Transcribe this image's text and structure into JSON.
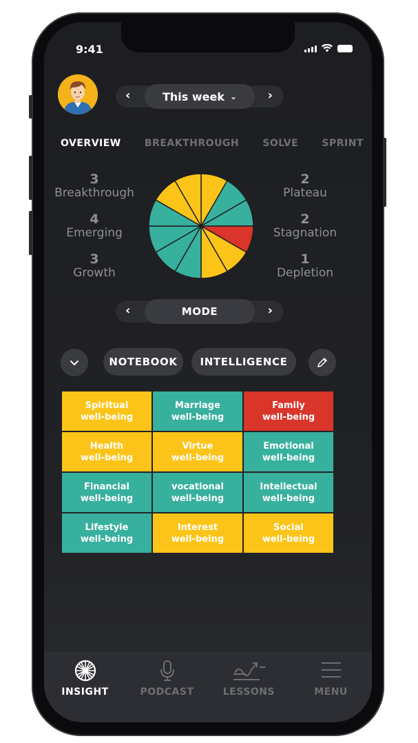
{
  "status_bar": {
    "time": "9:41"
  },
  "week_nav": {
    "label": "This week",
    "prev_icon": "chevron-left-icon",
    "next_icon": "chevron-right-icon",
    "caret_icon": "chevron-down-icon"
  },
  "tabs": [
    {
      "label": "OVERVIEW",
      "active": true
    },
    {
      "label": "BREAKTHROUGH",
      "active": false
    },
    {
      "label": "SOLVE",
      "active": false
    },
    {
      "label": "SPRINT",
      "active": false
    }
  ],
  "stats_left": [
    {
      "value": "3",
      "label": "Breakthrough"
    },
    {
      "value": "4",
      "label": "Emerging"
    },
    {
      "value": "3",
      "label": "Growth"
    }
  ],
  "stats_right": [
    {
      "value": "2",
      "label": "Plateau"
    },
    {
      "value": "2",
      "label": "Stagnation"
    },
    {
      "value": "1",
      "label": "Depletion"
    }
  ],
  "pie": {
    "colors": {
      "yellow": "#fcc419",
      "teal": "#38b09e",
      "red": "#d9352a"
    },
    "slices": [
      "yellow",
      "teal",
      "teal",
      "red",
      "yellow",
      "yellow",
      "teal",
      "teal",
      "teal",
      "teal",
      "yellow",
      "yellow"
    ]
  },
  "mode_nav": {
    "label": "MODE"
  },
  "actions": {
    "notebook": "NOTEBOOK",
    "intelligence": "INTELLIGENCE",
    "collapse_icon": "chevron-down-icon",
    "edit_icon": "pencil-icon"
  },
  "wellbeing": [
    {
      "line1": "Spiritual",
      "line2": "well-being",
      "color": "#fcc419"
    },
    {
      "line1": "Marriage",
      "line2": "well-being",
      "color": "#38b09e"
    },
    {
      "line1": "Family",
      "line2": "well-being",
      "color": "#d9352a"
    },
    {
      "line1": "Health",
      "line2": "well-being",
      "color": "#fcc419"
    },
    {
      "line1": "Virtue",
      "line2": "well-being",
      "color": "#fcc419"
    },
    {
      "line1": "Emotional",
      "line2": "well-being",
      "color": "#38b09e"
    },
    {
      "line1": "Financial",
      "line2": "well-being",
      "color": "#38b09e"
    },
    {
      "line1": "vocational",
      "line2": "well-being",
      "color": "#38b09e"
    },
    {
      "line1": "Intellectual",
      "line2": "well-being",
      "color": "#38b09e"
    },
    {
      "line1": "Lifestyle",
      "line2": "well-being",
      "color": "#38b09e"
    },
    {
      "line1": "Interest",
      "line2": "well-being",
      "color": "#fcc419"
    },
    {
      "line1": "Social",
      "line2": "well-being",
      "color": "#fcc419"
    }
  ],
  "bottom_nav": [
    {
      "label": "INSIGHT",
      "icon": "insight-icon",
      "active": true
    },
    {
      "label": "PODCAST",
      "icon": "microphone-icon",
      "active": false
    },
    {
      "label": "LESSONS",
      "icon": "lessons-icon",
      "active": false
    },
    {
      "label": "MENU",
      "icon": "menu-icon",
      "active": false
    }
  ]
}
